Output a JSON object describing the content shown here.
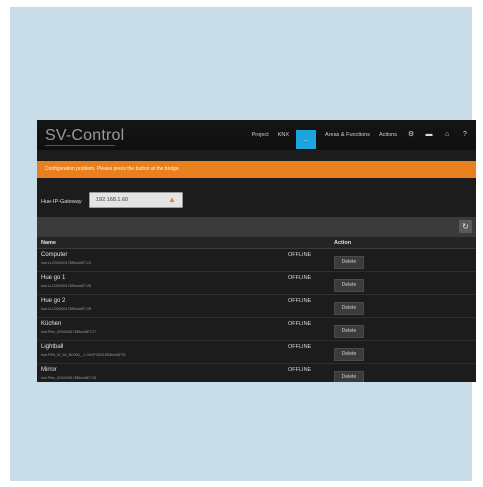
{
  "app": {
    "title": "SV-Control",
    "nav": [
      "Project",
      "KNX",
      "...",
      "Areas & Functions",
      "Actions"
    ],
    "nav_icons": [
      "gear-icon",
      "printer-icon",
      "home-icon",
      "help-icon"
    ],
    "accent_color": "#1aa6dc",
    "alert_color": "#e8801e"
  },
  "alert": {
    "text": "Configuration problem. Please press the button at the bridge."
  },
  "gateway": {
    "label": "Hue-IP-Gateway",
    "value": "192.168.1.60"
  },
  "table": {
    "headers": {
      "name": "Name",
      "action": "Action"
    },
    "rows": [
      {
        "name": "Computer",
        "id": "hue:LLC020/00178EbxxbE7:24",
        "status": "OFFLINE",
        "action": "Delete"
      },
      {
        "name": "Hue go 1",
        "id": "hue:LLC020/00178EbxxbE7:26",
        "status": "OFFLINE",
        "action": "Delete"
      },
      {
        "name": "Hue go 2",
        "id": "hue:LLC020/00178EbxxbE7:28",
        "status": "OFFLINE",
        "action": "Delete"
      },
      {
        "name": "Küchen",
        "id": "hue:Plex_0G00/00178EbxxbE7:27",
        "status": "OFFLINE",
        "action": "Delete"
      },
      {
        "name": "Lightball",
        "id": "hue:FBH_W_54_BC006__1.03/0F300/1EB4bc06F25",
        "status": "OFFLINE",
        "action": "Delete"
      },
      {
        "name": "Mirror",
        "id": "hue:Plex_0G00/00178EbxxbE7:28",
        "status": "OFFLINE",
        "action": "Delete"
      }
    ]
  }
}
